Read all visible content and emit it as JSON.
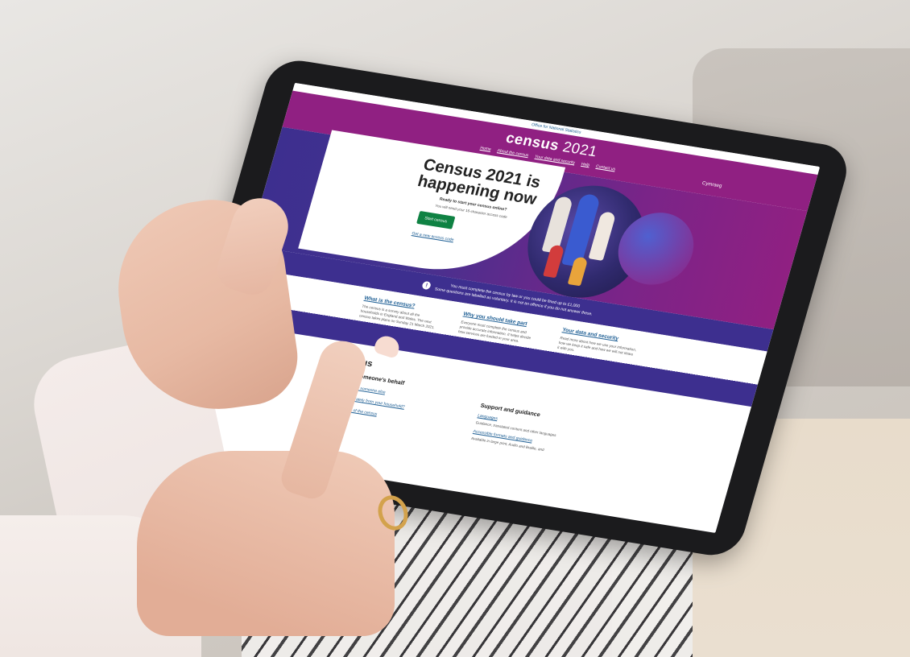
{
  "screen": {
    "ons_text": "Office for National Statistics",
    "logo_text": "census",
    "logo_year": "2021",
    "nav_items": [
      "Home",
      "About the census",
      "Your data and security",
      "Help",
      "Contact us"
    ],
    "language": "Cymraeg",
    "hero_title": "Census 2021 is happening now",
    "hero_subtitle": "Ready to start your census online?",
    "hero_subtitle2": "You will need your 16-character access code",
    "start_button": "Start census",
    "code_link": "Get a new access code",
    "notice_text": "You must complete the census by law or you could be fined up to £1,000",
    "notice_text2": "Some questions are labelled as voluntary. It is not an offence if you do not answer these.",
    "cards": [
      {
        "title": "What is the census?",
        "text": "The census is a survey about all the households in England and Wales. The next census takes place on Sunday 21 March 2021."
      },
      {
        "title": "Why you should take part",
        "text": "Everyone must complete the census and provide accurate information. It helps decide how services are funded in your area."
      },
      {
        "title": "Your data and security",
        "text": "Read more about how we use your information, how we keep it safe and how we will not share it with you."
      }
    ],
    "lower_heading": "the census",
    "lower_sub": "Take part on someone's behalf",
    "lower_links": [
      "Complete a census for someone else",
      "Can you answer separately from your household?",
      "Request a paper copy of the census"
    ],
    "support_heading": "Support and guidance",
    "support_links": [
      "Languages",
      "Accessible formats and guidance"
    ],
    "support_text": [
      "Guidance, translated content and other languages",
      "Available in large print, Audio and Braille, and"
    ]
  }
}
